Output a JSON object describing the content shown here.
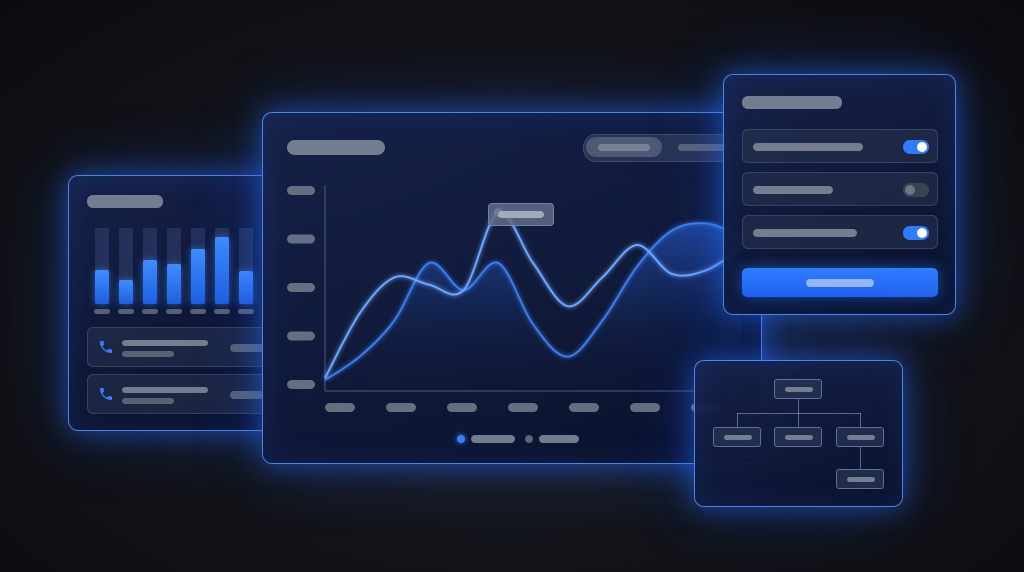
{
  "app": {
    "name": "",
    "accent_color": "#2f7bff",
    "glow_color": "#3a7dff",
    "background_color": "#121419"
  },
  "left_panel": {
    "header_placeholder": "",
    "bar_values": [
      0.45,
      0.32,
      0.58,
      0.52,
      0.72,
      0.88,
      0.44
    ],
    "contacts": [
      {
        "icon": "phone-icon",
        "name": "",
        "detail": "",
        "meta": ""
      },
      {
        "icon": "phone-icon",
        "name": "",
        "detail": "",
        "meta": ""
      }
    ]
  },
  "main_panel": {
    "title": "",
    "segmented_tabs": [
      {
        "label": "",
        "selected": true
      },
      {
        "label": "",
        "selected": false
      }
    ],
    "tooltip_label": "",
    "legend": [
      {
        "label": "",
        "color": "#3a7dff"
      },
      {
        "label": "",
        "color": "#5c6578"
      }
    ]
  },
  "chart_data": {
    "type": "line",
    "x": [
      0,
      1,
      2,
      3,
      4,
      5,
      6,
      7,
      8,
      9,
      10,
      11,
      12
    ],
    "series": [
      {
        "values": [
          0.06,
          0.42,
          0.62,
          0.58,
          0.55,
          0.98,
          0.7,
          0.46,
          0.62,
          0.8,
          0.64,
          0.66,
          0.78
        ]
      },
      {
        "values": [
          0.05,
          0.18,
          0.38,
          0.7,
          0.55,
          0.7,
          0.36,
          0.18,
          0.38,
          0.68,
          0.88,
          0.92,
          0.85
        ]
      }
    ],
    "ylim": [
      0,
      1
    ],
    "xlabel": "",
    "ylabel": "",
    "grid": false,
    "highlight_index": 5
  },
  "settings_panel": {
    "title": "",
    "toggles": [
      {
        "label": "",
        "on": true
      },
      {
        "label": "",
        "on": false
      },
      {
        "label": "",
        "on": true
      }
    ],
    "primary_button_label": ""
  },
  "flow_panel": {
    "nodes": [
      {
        "id": "root",
        "label": ""
      },
      {
        "id": "child-1",
        "label": ""
      },
      {
        "id": "child-2",
        "label": ""
      },
      {
        "id": "child-3",
        "label": ""
      },
      {
        "id": "child-3-1",
        "label": ""
      }
    ]
  }
}
